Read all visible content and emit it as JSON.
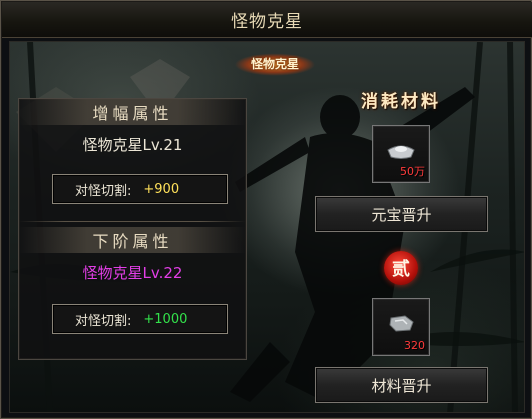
{
  "window": {
    "title": "怪物克星"
  },
  "banner": {
    "label": "怪物克星"
  },
  "boost": {
    "header": "增幅属性",
    "current_name": "怪物克星Lv.21",
    "stat_key": "对怪切割:",
    "stat_value": "+900"
  },
  "next": {
    "header": "下阶属性",
    "next_name": "怪物克星Lv.22",
    "stat_key": "对怪切割:",
    "stat_value": "+1000"
  },
  "materials": {
    "title": "消耗材料",
    "item1": {
      "icon": "silver-ingot-icon",
      "count": "50万"
    },
    "button1": "元宝晋升",
    "seal": "贰",
    "item2": {
      "icon": "material-stone-icon",
      "count": "320"
    },
    "button2": "材料晋升"
  },
  "colors": {
    "next_name": "#e23ee6",
    "stat_yellow": "#ffe15a",
    "stat_green": "#33e24b",
    "count_red": "#ff3b3b"
  }
}
